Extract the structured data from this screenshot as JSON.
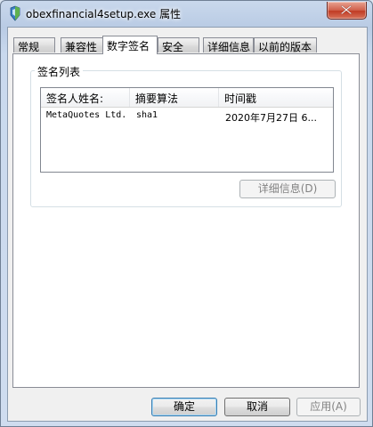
{
  "window": {
    "title": "obexfinancial4setup.exe 属性",
    "close_icon": "close-x-icon"
  },
  "tabs": [
    {
      "label": "常规",
      "active": false
    },
    {
      "label": "兼容性",
      "active": false
    },
    {
      "label": "数字签名",
      "active": true
    },
    {
      "label": "安全",
      "active": false
    },
    {
      "label": "详细信息",
      "active": false
    },
    {
      "label": "以前的版本",
      "active": false
    }
  ],
  "signature_list": {
    "group_label": "签名列表",
    "columns": [
      "签名人姓名:",
      "摘要算法",
      "时间戳"
    ],
    "rows": [
      {
        "signer": "MetaQuotes Ltd.",
        "algorithm": "sha1",
        "timestamp": "2020年7月27日 6..."
      }
    ],
    "details_button": "详细信息(D)"
  },
  "footer": {
    "ok": "确定",
    "cancel": "取消",
    "apply": "应用(A)"
  }
}
